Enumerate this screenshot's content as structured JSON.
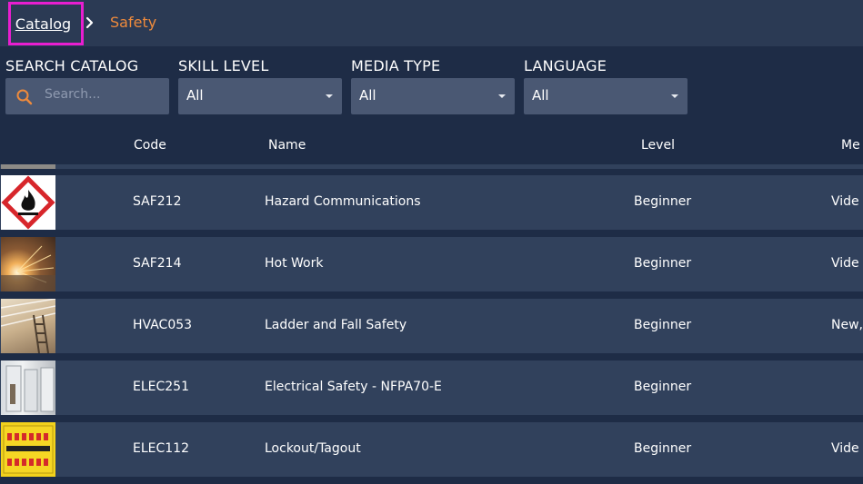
{
  "breadcrumb": {
    "root": "Catalog",
    "current": "Safety"
  },
  "filters": {
    "search": {
      "label": "SEARCH CATALOG",
      "placeholder": "Search..."
    },
    "skill_level": {
      "label": "SKILL LEVEL",
      "value": "All"
    },
    "media_type": {
      "label": "MEDIA TYPE",
      "value": "All"
    },
    "language": {
      "label": "LANGUAGE",
      "value": "All"
    }
  },
  "table": {
    "columns": {
      "code": "Code",
      "name": "Name",
      "level": "Level",
      "media": "Me"
    },
    "rows": [
      {
        "code": "SAF212",
        "name": "Hazard Communications",
        "level": "Beginner",
        "media": "Vide",
        "thumb": "flammable-pictogram"
      },
      {
        "code": "SAF214",
        "name": "Hot Work",
        "level": "Beginner",
        "media": "Vide",
        "thumb": "grinding-sparks-photo"
      },
      {
        "code": "HVAC053",
        "name": "Ladder and Fall Safety",
        "level": "Beginner",
        "media": "New,",
        "thumb": "ladder-photo"
      },
      {
        "code": "ELEC251",
        "name": "Electrical Safety - NFPA70-E",
        "level": "Beginner",
        "media": "",
        "thumb": "electrical-panel-photo"
      },
      {
        "code": "ELEC112",
        "name": "Lockout/Tagout",
        "level": "Beginner",
        "media": "Vide",
        "thumb": "lockout-board-photo"
      }
    ]
  },
  "colors": {
    "background": "#1e2c46",
    "topbar": "#2b3a54",
    "row": "#31415c",
    "field": "#4a5873",
    "accent_orange": "#ee8a3c",
    "highlight_magenta": "#e81ed0"
  }
}
